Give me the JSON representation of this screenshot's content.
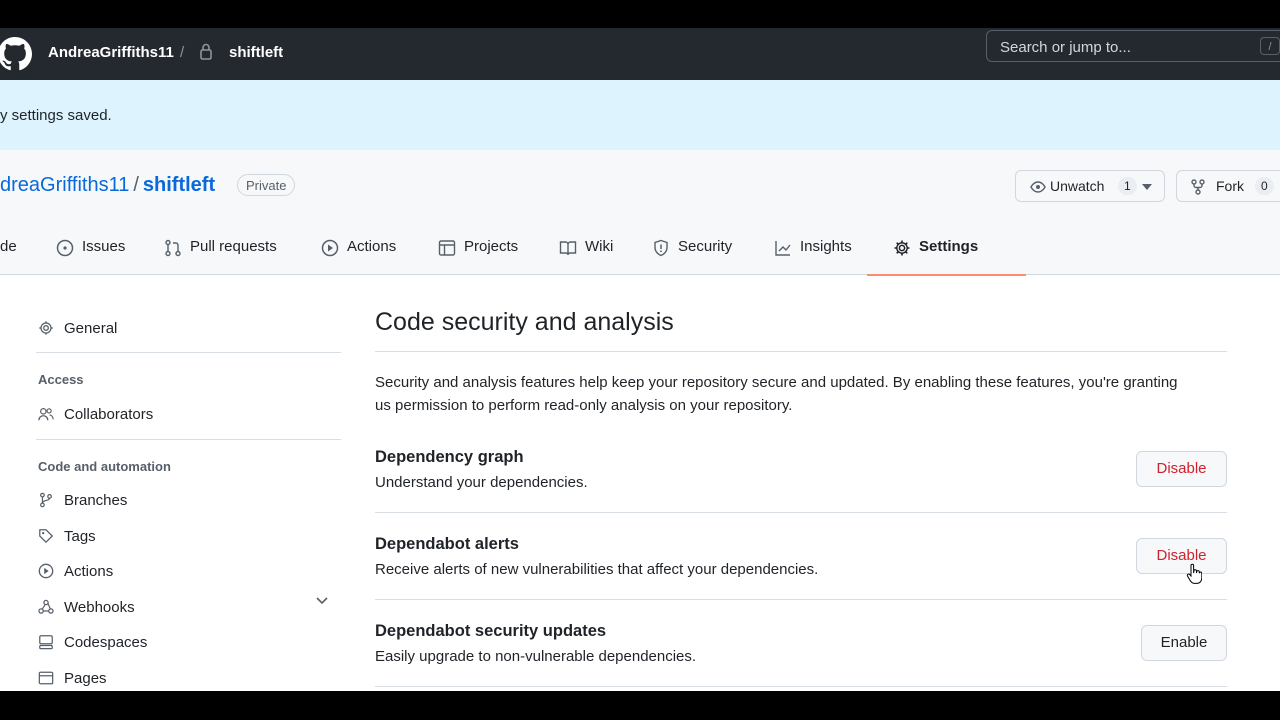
{
  "topbar": {
    "owner": "AndreaGriffiths11",
    "separator": "/",
    "repo": "shiftleft",
    "search_placeholder": "Search or jump to...",
    "search_shortcut": "/"
  },
  "flash": {
    "message": "y settings saved."
  },
  "repo_header": {
    "owner": "dreaGriffiths11",
    "separator": "/",
    "repo": "shiftleft",
    "visibility": "Private",
    "watch_label": "Unwatch",
    "watch_count": "1",
    "fork_label": "Fork",
    "fork_count": "0"
  },
  "tabs": [
    {
      "label": "de",
      "icon": "code-icon"
    },
    {
      "label": "Issues",
      "icon": "issue-icon"
    },
    {
      "label": "Pull requests",
      "icon": "pull-request-icon"
    },
    {
      "label": "Actions",
      "icon": "play-icon"
    },
    {
      "label": "Projects",
      "icon": "table-icon"
    },
    {
      "label": "Wiki",
      "icon": "book-icon"
    },
    {
      "label": "Security",
      "icon": "shield-icon"
    },
    {
      "label": "Insights",
      "icon": "graph-icon"
    },
    {
      "label": "Settings",
      "icon": "gear-icon",
      "selected": true
    }
  ],
  "sidebar": {
    "general": "General",
    "access_heading": "Access",
    "collaborators": "Collaborators",
    "code_heading": "Code and automation",
    "items": [
      "Branches",
      "Tags",
      "Actions",
      "Webhooks",
      "Codespaces",
      "Pages"
    ]
  },
  "main": {
    "title": "Code security and analysis",
    "intro": "Security and analysis features help keep your repository secure and updated. By enabling these features, you're granting us permission to perform read-only analysis on your repository.",
    "features": [
      {
        "title": "Dependency graph",
        "desc": "Understand your dependencies.",
        "button": "Disable"
      },
      {
        "title": "Dependabot alerts",
        "desc": "Receive alerts of new vulnerabilities that affect your dependencies.",
        "button": "Disable"
      },
      {
        "title": "Dependabot security updates",
        "desc": "Easily upgrade to non-vulnerable dependencies.",
        "button": "Enable"
      }
    ]
  },
  "colors": {
    "topbar_bg": "#24292f",
    "flash_bg": "#ddf4ff",
    "link": "#0969da",
    "danger": "#cf222e",
    "selected_tab_underline": "#fd8c73"
  }
}
